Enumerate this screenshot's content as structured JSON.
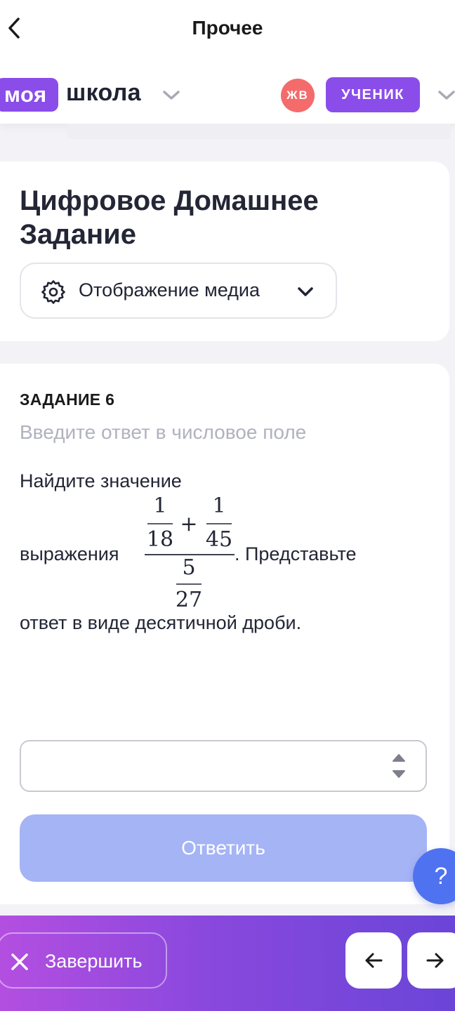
{
  "topbar": {
    "title": "Прочее",
    "back_icon": "chevron-left-icon"
  },
  "school": {
    "logo_pill": "моя",
    "logo_text": "школа",
    "avatar_initials": "ЖВ",
    "role": "УЧЕНИК",
    "accent": "#8b4dea",
    "avatar_color": "#f46b6b"
  },
  "homework": {
    "title": "Цифровое Домашнее Задание",
    "media_button": "Отображение медиа",
    "media_icon": "gear-icon"
  },
  "task": {
    "label": "ЗАДАНИЕ 6",
    "hint": "Введите ответ в числовое поле",
    "line1": "Найдите значение",
    "line2_before": "выражения",
    "line2_after": ".  Представьте",
    "line3": "ответ в виде десятичной дроби.",
    "expression": {
      "num_a": "1",
      "den_a": "18",
      "op": "+",
      "num_b": "1",
      "den_b": "45",
      "num_c": "5",
      "den_c": "27"
    },
    "answer_value": "",
    "submit_label": "Ответить",
    "submit_color": "#a5b4f5"
  },
  "help": {
    "label": "?"
  },
  "footer": {
    "finish_label": "Завершить",
    "prev_icon": "arrow-left-icon",
    "next_icon": "arrow-right-icon"
  }
}
